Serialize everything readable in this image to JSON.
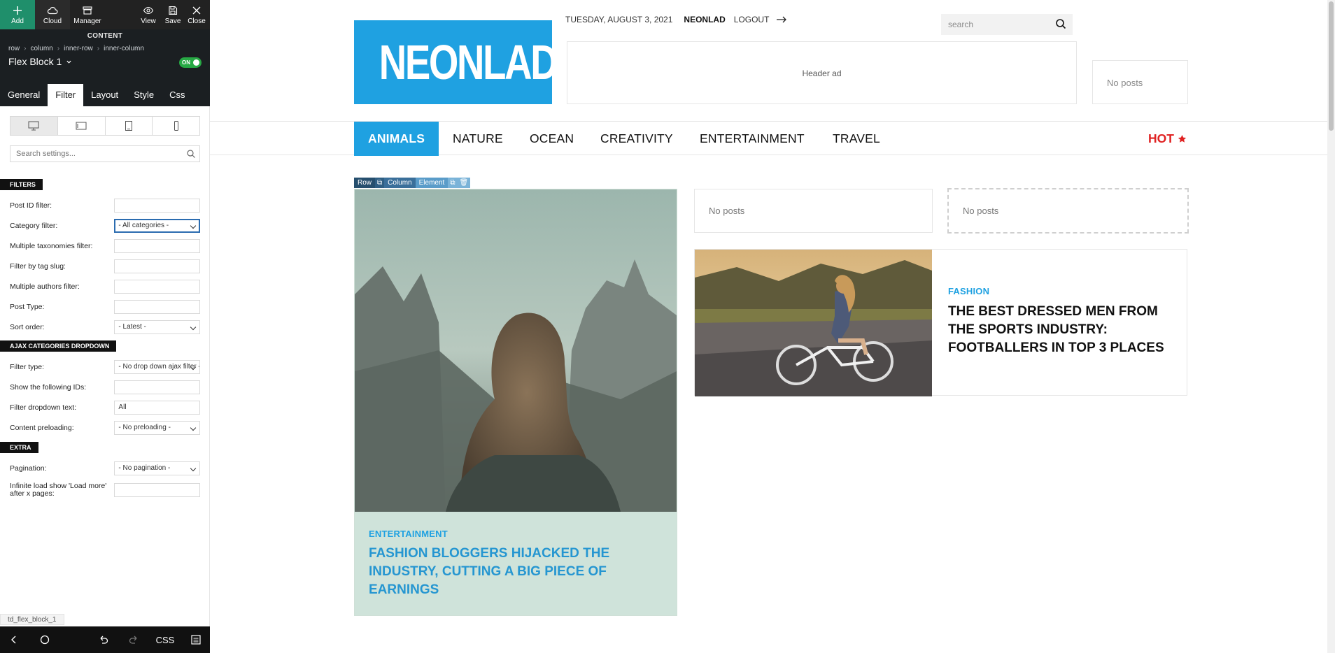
{
  "toolbar": {
    "add": "Add",
    "cloud": "Cloud",
    "manager": "Manager",
    "view": "View",
    "save": "Save",
    "close": "Close"
  },
  "panel_header": {
    "section_label": "CONTENT",
    "breadcrumb": [
      "row",
      "column",
      "inner-row",
      "inner-column"
    ],
    "block_title": "Flex Block 1",
    "toggle_label": "ON"
  },
  "tabs": [
    {
      "label": "General",
      "active": false
    },
    {
      "label": "Filter",
      "active": true
    },
    {
      "label": "Layout",
      "active": false
    },
    {
      "label": "Style",
      "active": false
    },
    {
      "label": "Css",
      "active": false
    }
  ],
  "devices": [
    "desktop-icon",
    "tablet-landscape-icon",
    "tablet-portrait-icon",
    "phone-icon"
  ],
  "settings_search": {
    "placeholder": "Search settings..."
  },
  "sections": {
    "filters": "FILTERS",
    "ajax": "AJAX CATEGORIES DROPDOWN",
    "extra": "EXTRA"
  },
  "fields": {
    "post_id": {
      "label": "Post ID filter:",
      "value": ""
    },
    "category": {
      "label": "Category filter:",
      "value": "- All categories -"
    },
    "taxonomies": {
      "label": "Multiple taxonomies filter:",
      "value": ""
    },
    "tag_slug": {
      "label": "Filter by tag slug:",
      "value": ""
    },
    "authors": {
      "label": "Multiple authors filter:",
      "value": ""
    },
    "post_type": {
      "label": "Post Type:",
      "value": ""
    },
    "sort_order": {
      "label": "Sort order:",
      "value": "- Latest -"
    },
    "filter_type": {
      "label": "Filter type:",
      "value": "- No drop down ajax filter -"
    },
    "show_ids": {
      "label": "Show the following IDs:",
      "value": ""
    },
    "dropdown_text": {
      "label": "Filter dropdown text:",
      "value": "All"
    },
    "preloading": {
      "label": "Content preloading:",
      "value": "- No preloading -"
    },
    "pagination": {
      "label": "Pagination:",
      "value": "- No pagination -"
    },
    "infinite": {
      "label": "Infinite load show 'Load more' after x pages:",
      "value": ""
    }
  },
  "status_id": "td_flex_block_1",
  "bottombar": {
    "css_label": "CSS"
  },
  "site": {
    "logo_text": "NEONLAD",
    "date": "TUESDAY, AUGUST 3, 2021",
    "username": "NEONLAD",
    "logout": "LOGOUT",
    "search_placeholder": "search",
    "header_ad": "Header ad",
    "header_no_posts": "No posts",
    "nav": [
      "ANIMALS",
      "NATURE",
      "OCEAN",
      "CREATIVITY",
      "ENTERTAINMENT",
      "TRAVEL"
    ],
    "nav_hot": "HOT",
    "editbar": {
      "row": "Row",
      "column": "Column",
      "element": "Element"
    },
    "featured": {
      "category": "ENTERTAINMENT",
      "title": "FASHION BLOGGERS HIJACKED THE INDUSTRY, CUTTING A BIG PIECE OF EARNINGS"
    },
    "no_posts_1": "No posts",
    "no_posts_2": "No posts",
    "card": {
      "category": "FASHION",
      "title": "THE BEST DRESSED MEN FROM THE SPORTS INDUSTRY: FOOTBALLERS IN TOP 3 PLACES"
    }
  },
  "colors": {
    "accent": "#1fa1e1",
    "panel_dark": "#1b1f22",
    "hot": "#e02222",
    "toggle_on": "#27a844"
  }
}
